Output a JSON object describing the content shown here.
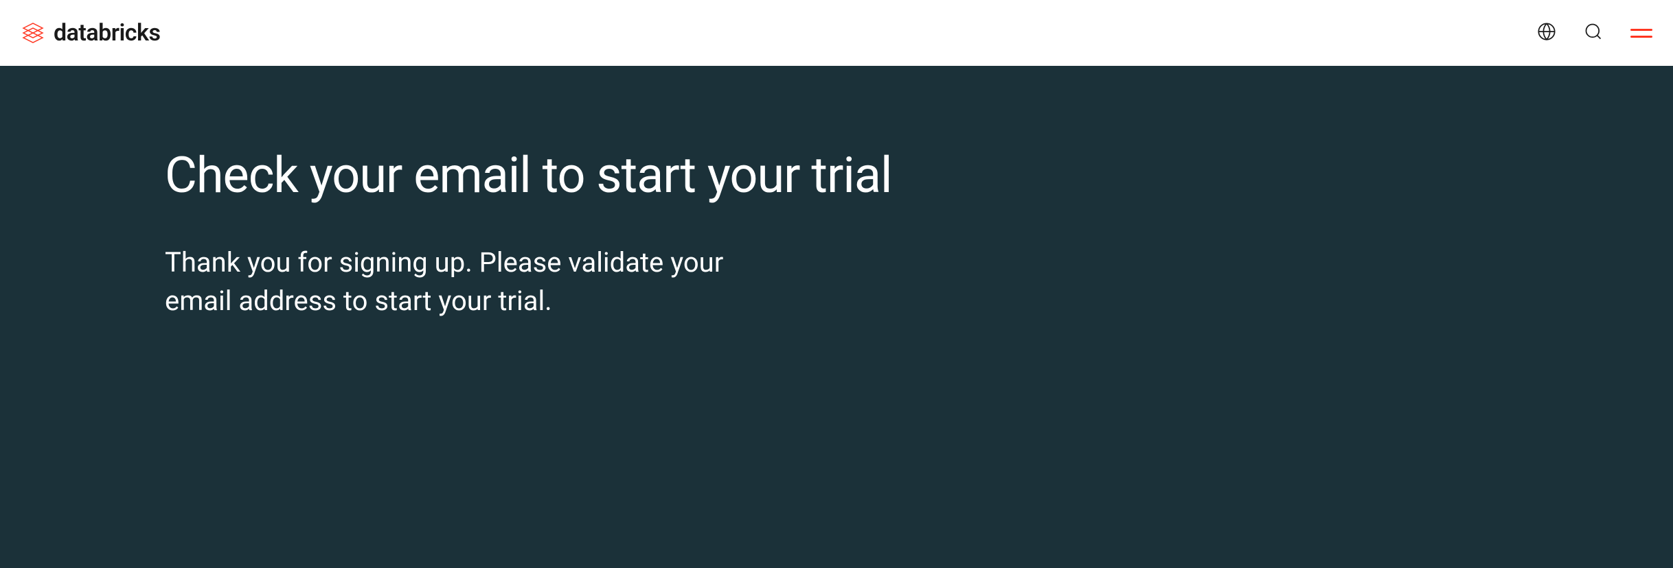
{
  "header": {
    "brand_name": "databricks",
    "brand_color": "#ff3621"
  },
  "hero": {
    "title": "Check your email to start your trial",
    "subtitle": "Thank you for signing up. Please validate your email address to start your trial.",
    "background_color": "#1b3139"
  }
}
